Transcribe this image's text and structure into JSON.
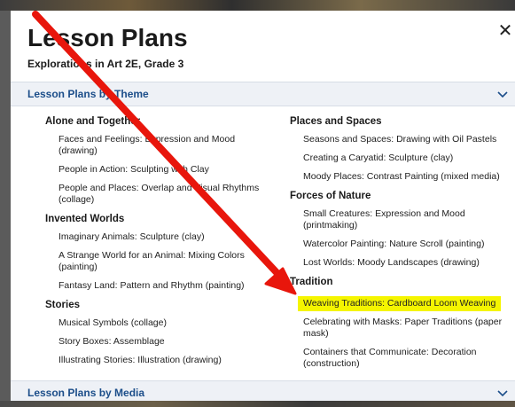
{
  "modal": {
    "title": "Lesson Plans",
    "subtitle": "Explorations in Art 2E, Grade 3",
    "close_label": "✕"
  },
  "accordions": [
    {
      "label": "Lesson Plans by Theme",
      "expanded": true
    },
    {
      "label": "Lesson Plans by Media",
      "expanded": false
    }
  ],
  "theme_columns": {
    "left": [
      {
        "heading": "Alone and Together",
        "items": [
          "Faces and Feelings: Expression and Mood (drawing)",
          "People in Action: Sculpting with Clay",
          "People and Places: Overlap and Visual Rhythms (collage)"
        ]
      },
      {
        "heading": "Invented Worlds",
        "items": [
          "Imaginary Animals: Sculpture (clay)",
          "A Strange World for an Animal: Mixing Colors (painting)",
          "Fantasy Land: Pattern and Rhythm (painting)"
        ]
      },
      {
        "heading": "Stories",
        "items": [
          "Musical Symbols (collage)",
          "Story Boxes: Assemblage",
          "Illustrating Stories: Illustration (drawing)"
        ]
      }
    ],
    "right": [
      {
        "heading": "Places and Spaces",
        "items": [
          "Seasons and Spaces: Drawing with Oil Pastels",
          "Creating a Caryatid: Sculpture (clay)",
          "Moody Places: Contrast Painting (mixed media)"
        ]
      },
      {
        "heading": "Forces of Nature",
        "items": [
          "Small Creatures: Expression and Mood (printmaking)",
          "Watercolor Painting: Nature Scroll (painting)",
          "Lost Worlds: Moody Landscapes (drawing)"
        ]
      },
      {
        "heading": "Tradition",
        "items": [
          "Weaving Traditions: Cardboard Loom Weaving",
          "Celebrating with Masks: Paper Traditions (paper mask)",
          "Containers that Communicate: Decoration (construction)"
        ]
      }
    ]
  },
  "highlighted_item": "Weaving Traditions: Cardboard Loom Weaving",
  "colors": {
    "accent_text": "#1c4e8a",
    "accordion_bg": "#eef1f6",
    "highlight": "#f5f500",
    "arrow": "#e8160c"
  },
  "icons": {
    "close": "close-icon",
    "chevron": "chevron-down-icon",
    "annotation": "red-arrow-annotation"
  }
}
